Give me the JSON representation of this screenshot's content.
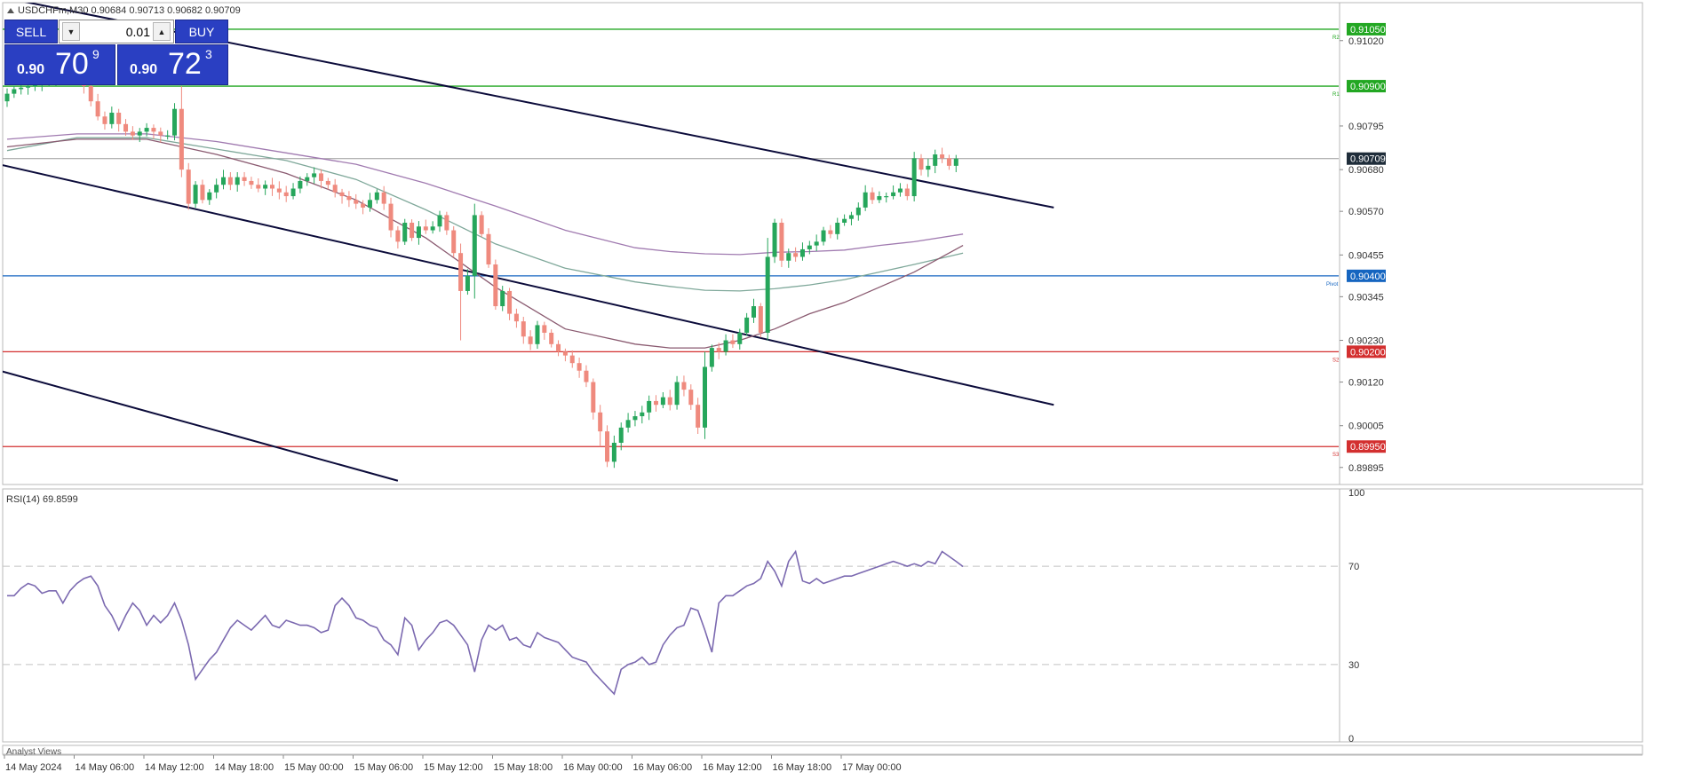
{
  "chart_data": [
    {
      "type": "candlestick",
      "title": "USDCHFm,M30",
      "ohlc_header": "0.90684 0.90713 0.90682 0.90709",
      "ylim": [
        0.8985,
        0.9112
      ],
      "price_ticks": [
        "0.91020",
        "0.90795",
        "0.90680",
        "0.90570",
        "0.90455",
        "0.90345",
        "0.90230",
        "0.90120",
        "0.90005",
        "0.89895"
      ],
      "time_ticks": [
        "14 May 2024",
        "14 May 06:00",
        "14 May 12:00",
        "14 May 18:00",
        "15 May 00:00",
        "15 May 06:00",
        "15 May 12:00",
        "15 May 18:00",
        "16 May 00:00",
        "16 May 06:00",
        "16 May 12:00",
        "16 May 18:00",
        "17 May 00:00"
      ],
      "current_price": {
        "value": 0.90709,
        "label": "0.90709"
      },
      "levels": [
        {
          "name": "R2",
          "value": 0.9105,
          "label": "0.91050",
          "color": "#22a722"
        },
        {
          "name": "R1",
          "value": 0.909,
          "label": "0.90900",
          "color": "#22a722"
        },
        {
          "name": "Pivot",
          "value": 0.904,
          "label": "0.90400",
          "color": "#1565c0"
        },
        {
          "name": "S2",
          "value": 0.902,
          "label": "0.90200",
          "color": "#d32f2f"
        },
        {
          "name": "S3",
          "value": 0.8995,
          "label": "0.89950",
          "color": "#d32f2f"
        }
      ],
      "level_tags": [
        "R2",
        "R1",
        "Pivot",
        "S2",
        "S3"
      ],
      "channel_lines": [
        {
          "from": [
            -5,
            0.9115
          ],
          "to": [
            150,
            0.9058
          ]
        },
        {
          "from": [
            -5,
            0.9071
          ],
          "to": [
            150,
            0.9006
          ]
        },
        {
          "from": [
            -5,
            0.9017
          ],
          "to": [
            56,
            0.8986
          ]
        }
      ],
      "candle_colors": {
        "bull": "#26a65b",
        "bear": "#ef8a7e"
      },
      "ma_colors": [
        "#a07ab0",
        "#7fa89a",
        "#8a5a70"
      ],
      "close": [
        0.9088,
        0.90892,
        0.90896,
        0.909,
        0.90904,
        0.90908,
        0.90912,
        0.90916,
        0.90918,
        0.90922,
        0.9092,
        0.909,
        0.9086,
        0.9082,
        0.908,
        0.9083,
        0.908,
        0.9078,
        0.9077,
        0.9078,
        0.9079,
        0.9078,
        0.9077,
        0.9077,
        0.9084,
        0.9068,
        0.9059,
        0.9064,
        0.906,
        0.9062,
        0.9064,
        0.9066,
        0.9064,
        0.9066,
        0.9065,
        0.9064,
        0.9063,
        0.9064,
        0.9063,
        0.9062,
        0.9061,
        0.9063,
        0.9065,
        0.9066,
        0.9067,
        0.9065,
        0.9064,
        0.9062,
        0.9061,
        0.906,
        0.9059,
        0.9058,
        0.906,
        0.9062,
        0.9059,
        0.9052,
        0.9049,
        0.9054,
        0.905,
        0.9053,
        0.9052,
        0.9053,
        0.9056,
        0.9052,
        0.9046,
        0.9036,
        0.904,
        0.9056,
        0.9051,
        0.9043,
        0.9032,
        0.9036,
        0.903,
        0.9028,
        0.9024,
        0.9022,
        0.9027,
        0.9025,
        0.9022,
        0.902,
        0.9019,
        0.9017,
        0.9015,
        0.9012,
        0.9004,
        0.8999,
        0.8991,
        0.8996,
        0.9,
        0.9002,
        0.9003,
        0.9004,
        0.9007,
        0.9006,
        0.9008,
        0.9006,
        0.9012,
        0.901,
        0.9006,
        0.9,
        0.9016,
        0.9021,
        0.902,
        0.9023,
        0.9022,
        0.9025,
        0.9029,
        0.9032,
        0.9025,
        0.9045,
        0.9054,
        0.9044,
        0.9046,
        0.9045,
        0.9047,
        0.9048,
        0.9049,
        0.9052,
        0.9051,
        0.9054,
        0.9055,
        0.9056,
        0.9058,
        0.9062,
        0.906,
        0.9061,
        0.9061,
        0.9062,
        0.9063,
        0.9061,
        0.9071,
        0.9068,
        0.9069,
        0.9072,
        0.9071,
        0.9069,
        0.90709
      ],
      "ma_sample_idx": [
        0,
        10,
        20,
        30,
        40,
        50,
        60,
        70,
        80,
        90,
        95,
        100,
        105,
        110,
        115,
        120,
        125,
        130,
        137
      ],
      "ma_series": [
        {
          "values": [
            0.9076,
            0.90774,
            0.90774,
            0.90754,
            0.90724,
            0.90694,
            0.90644,
            0.90584,
            0.9052,
            0.90474,
            0.90464,
            0.90458,
            0.90456,
            0.90462,
            0.90464,
            0.90468,
            0.9048,
            0.9049,
            0.9051
          ]
        },
        {
          "values": [
            0.9073,
            0.90764,
            0.90764,
            0.90734,
            0.90704,
            0.90654,
            0.90574,
            0.90484,
            0.9042,
            0.90384,
            0.90372,
            0.90362,
            0.9036,
            0.90366,
            0.90376,
            0.9039,
            0.9041,
            0.9043,
            0.9046
          ]
        },
        {
          "values": [
            0.9074,
            0.9076,
            0.9076,
            0.9072,
            0.9067,
            0.906,
            0.905,
            0.9037,
            0.9026,
            0.9022,
            0.9021,
            0.9021,
            0.9023,
            0.9026,
            0.903,
            0.9033,
            0.9037,
            0.9041,
            0.9048
          ]
        }
      ]
    },
    {
      "type": "line",
      "title": "RSI(14) 69.8599",
      "ylim": [
        0,
        100
      ],
      "y_ticks": [
        100,
        70,
        30,
        0
      ],
      "levels": [
        70,
        30
      ],
      "line_color": "#7b69b0",
      "values": [
        58,
        58,
        61,
        63,
        62,
        59,
        60,
        60,
        55,
        60,
        63,
        65,
        66,
        62,
        54,
        50,
        44,
        50,
        55,
        52,
        46,
        50,
        47,
        50,
        55,
        48,
        38,
        24,
        28,
        32,
        35,
        40,
        45,
        48,
        46,
        44,
        47,
        50,
        46,
        45,
        48,
        47,
        46,
        46,
        45,
        43,
        44,
        54,
        57,
        54,
        49,
        48,
        46,
        45,
        40,
        38,
        34,
        49,
        46,
        36,
        40,
        43,
        47,
        48,
        46,
        42,
        38,
        27,
        40,
        46,
        44,
        46,
        40,
        41,
        38,
        37,
        43,
        41,
        40,
        39,
        36,
        33,
        32,
        31,
        27,
        24,
        21,
        18,
        28,
        30,
        31,
        33,
        30,
        31,
        38,
        42,
        45,
        46,
        53,
        52,
        44,
        35,
        55,
        58,
        58,
        60,
        62,
        63,
        65,
        72,
        68,
        62,
        72,
        76,
        64,
        63,
        65,
        63,
        64,
        65,
        66,
        66,
        67,
        68,
        69,
        70,
        71,
        72,
        71,
        70,
        71,
        70,
        72,
        71,
        76,
        74,
        72,
        69.86
      ]
    }
  ],
  "trade_panel": {
    "sell_label": "SELL",
    "buy_label": "BUY",
    "lot_value": "0.01",
    "spin_down": "▼",
    "spin_up": "▲",
    "bid_small": "0.90",
    "bid_big": "70",
    "bid_sup": "9",
    "ask_small": "0.90",
    "ask_big": "72",
    "ask_sup": "3"
  },
  "footer": {
    "analyst_label": "Analyst Views"
  }
}
